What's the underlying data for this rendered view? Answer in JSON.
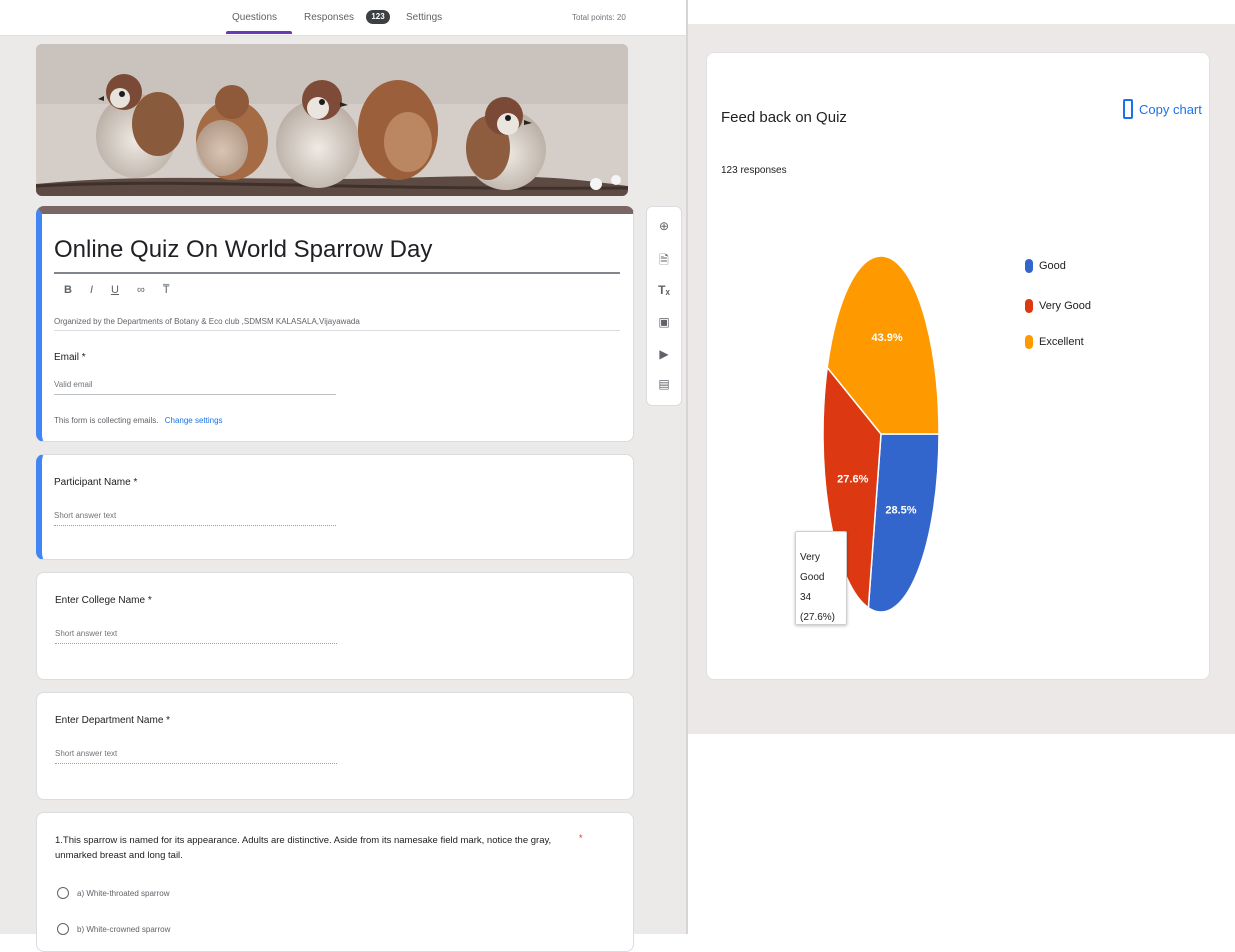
{
  "topbar": {
    "tabs": [
      "Questions",
      "Responses",
      "Settings"
    ],
    "responses_count": "123",
    "total_points": "Total points: 20"
  },
  "form": {
    "title": "Online Quiz On World Sparrow Day",
    "description": "Organized by the Departments of Botany & Eco club ,SDMSM KALASALA,Vijayawada",
    "format_tools": [
      "B",
      "I",
      "U",
      "link",
      "clear"
    ],
    "email_label": "Email *",
    "email_placeholder": "Valid email",
    "collecting_note": "This form is collecting emails.",
    "change_settings": "Change settings"
  },
  "questions": [
    {
      "label": "Participant Name *",
      "placeholder": "Short answer text"
    },
    {
      "label": "Enter College Name *",
      "placeholder": "Short answer text"
    },
    {
      "label": "Enter Department Name *",
      "placeholder": "Short answer text"
    }
  ],
  "q1": {
    "text": "1.This sparrow is named for its appearance. Adults are distinctive. Aside from its namesake field mark, notice the gray, unmarked breast and long tail.",
    "required": "*",
    "options": [
      "a) White-throated sparrow",
      "b) White-crowned sparrow"
    ]
  },
  "side_toolbar": [
    "add-question",
    "import-questions",
    "add-title",
    "add-image",
    "add-video",
    "add-section"
  ],
  "colors": {
    "good": "#3366cc",
    "very_good": "#dc3912",
    "excellent": "#ff9900",
    "accent": "#673ab7",
    "link": "#1a73e8"
  },
  "chart_card": {
    "copy_label": "Copy chart",
    "tooltip": {
      "label": "Very Good",
      "value": "34 (27.6%)"
    }
  },
  "chart_data": {
    "type": "pie",
    "title": "Feed back on Quiz",
    "subtitle": "123 responses",
    "categories": [
      "Good",
      "Very Good",
      "Excellent"
    ],
    "values": [
      28.5,
      27.6,
      43.9
    ],
    "labels": [
      "28.5%",
      "27.6%",
      "43.9%"
    ],
    "legend_position": "right"
  }
}
